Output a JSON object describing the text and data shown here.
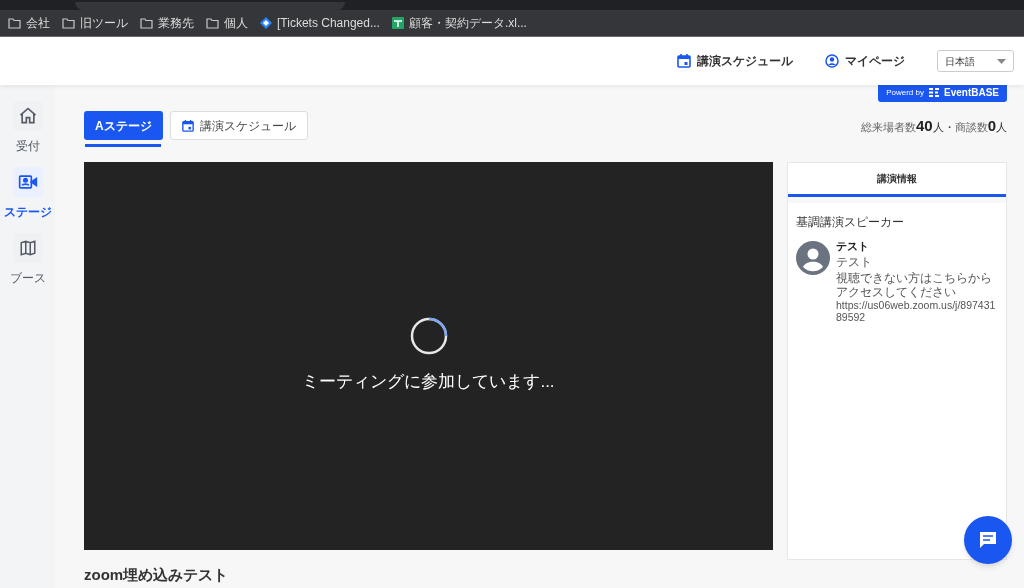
{
  "browser": {
    "bookmarks": [
      {
        "kind": "folder",
        "label": "会社"
      },
      {
        "kind": "folder",
        "label": "旧ツール"
      },
      {
        "kind": "folder",
        "label": "業務先"
      },
      {
        "kind": "folder",
        "label": "個人"
      },
      {
        "kind": "diamond",
        "label": "[Tickets Changed..."
      },
      {
        "kind": "sheet",
        "label": "顧客・契約データ.xl..."
      }
    ]
  },
  "header": {
    "links": [
      {
        "kind": "calendar",
        "label": "講演スケジュール"
      },
      {
        "kind": "user",
        "label": "マイページ"
      }
    ],
    "language": "日本語",
    "powered_by": "Powerd by",
    "brand": "EventBASE"
  },
  "sidebar": {
    "items": [
      {
        "kind": "home",
        "label": "受付",
        "selected": false
      },
      {
        "kind": "stage",
        "label": "ステージ",
        "selected": true
      },
      {
        "kind": "map",
        "label": "ブース",
        "selected": false
      }
    ]
  },
  "tabs": [
    {
      "kind": "plain",
      "label": "Aステージ",
      "selected": true
    },
    {
      "kind": "calendar",
      "label": "講演スケジュール",
      "selected": false
    }
  ],
  "stats": [
    {
      "label": "総来場者数",
      "value": "40",
      "unit": "人・"
    },
    {
      "label": "商談数",
      "value": "0",
      "unit": "人"
    }
  ],
  "video": {
    "status": "ミーティングに参加しています..."
  },
  "info_panel": {
    "tab": "講演情報",
    "section": "基調講演スピーカー",
    "speaker": {
      "name": "テスト",
      "title": "テスト",
      "description": "視聴できない方はこちらからアクセスしてください",
      "url": "https://us06web.zoom.us/j/89743189592"
    }
  },
  "page_title": "zoom埋め込みテスト"
}
